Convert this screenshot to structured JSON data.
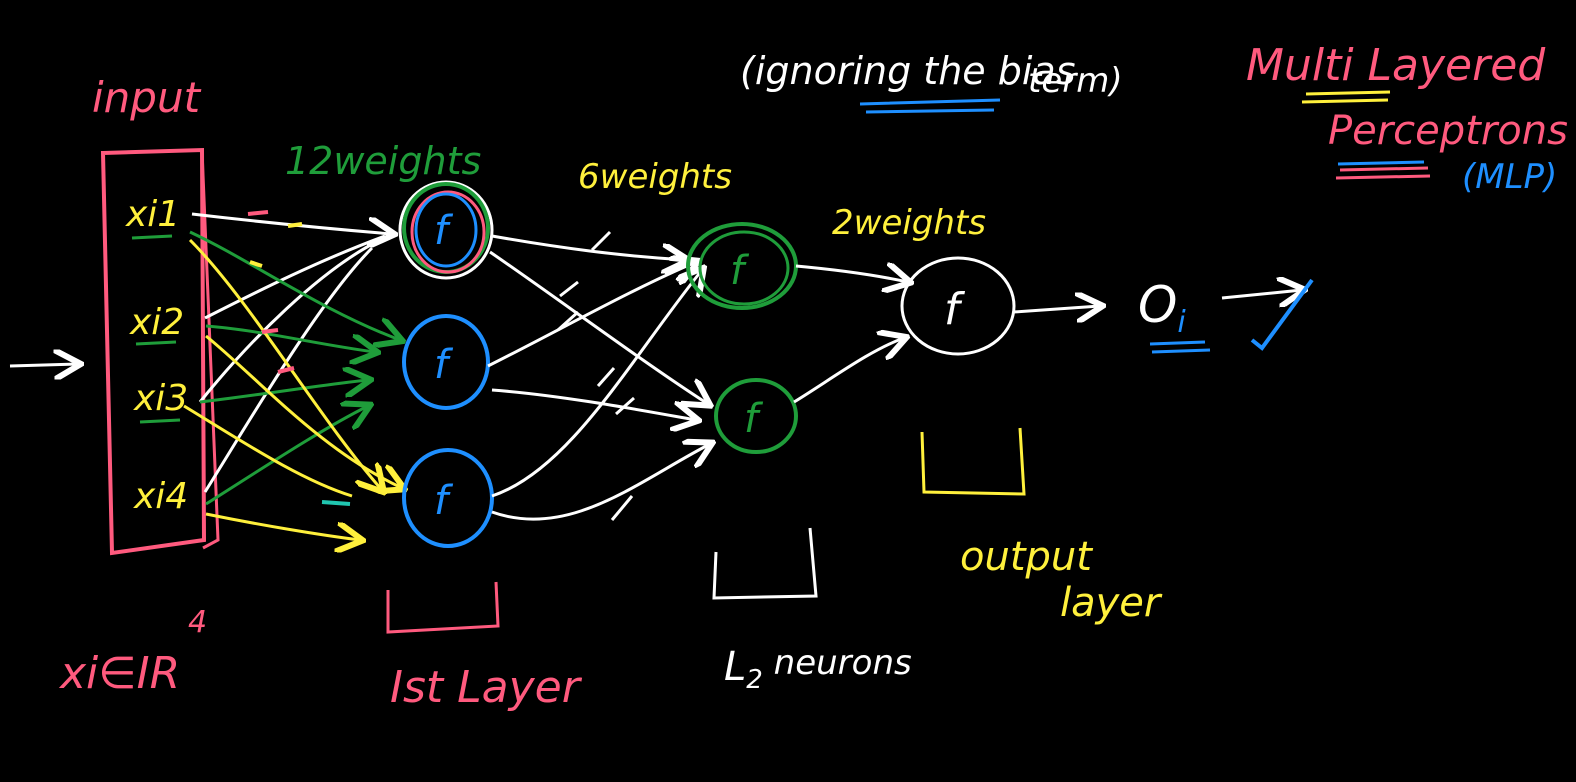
{
  "colors": {
    "background": "#000000",
    "white": "#ffffff",
    "pink": "#ff5a7e",
    "yellow": "#fff03c",
    "green": "#1f9d3a",
    "blue": "#1e8fff",
    "teal": "#20c6b0"
  },
  "labels": {
    "input": "input",
    "x1": "xi1",
    "x2": "xi2",
    "x3": "xi3",
    "x4": "xi4",
    "domain": "xi∈IR",
    "domain_sup": "4",
    "w12": "12weights",
    "w6": "6weights",
    "w2": "2weights",
    "bias_line1": "(ignoring the bias",
    "bias_line2": "term)",
    "mlp_line1": "Multi Layered",
    "mlp_line2": "Perceptrons",
    "mlp_abbr": "(MLP)",
    "layer1": "Ist Layer",
    "l2_main": "L",
    "l2_sub": "2",
    "l2_rest": " neurons",
    "output_line1": "output",
    "output_line2": "layer",
    "neuron_f": "f",
    "out_main": "O",
    "out_sub": "i"
  }
}
